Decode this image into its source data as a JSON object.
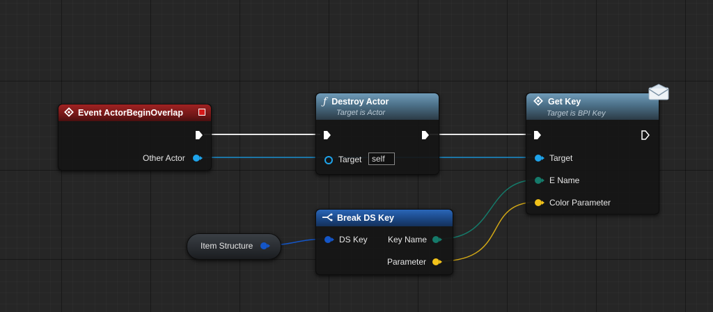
{
  "nodes": {
    "event": {
      "title": "Event ActorBeginOverlap",
      "other_actor_label": "Other Actor"
    },
    "destroy": {
      "title": "Destroy Actor",
      "subtitle": "Target is Actor",
      "target_label": "Target",
      "target_value": "self"
    },
    "getkey": {
      "title": "Get Key",
      "subtitle": "Target is BPI Key",
      "target_label": "Target",
      "ename_label": "E Name",
      "color_param_label": "Color Parameter"
    },
    "breakkey": {
      "title": "Break DS Key",
      "input_label": "DS Key",
      "keyname_label": "Key Name",
      "parameter_label": "Parameter"
    },
    "itemstruct": {
      "label": "Item Structure"
    }
  },
  "colors": {
    "object_pin": "#1ea3ea",
    "struct_pin": "#1456c8",
    "name_pin": "#157a6a",
    "color_pin": "#f2c21a",
    "exec": "#ffffff"
  },
  "icons": {
    "event": "event-diamond-icon",
    "function": "function-f-icon",
    "getkey": "interface-diamond-icon",
    "message": "envelope-message-icon",
    "break": "break-struct-icon"
  }
}
